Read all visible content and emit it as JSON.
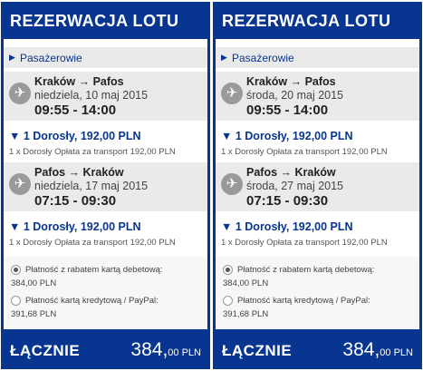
{
  "panels": [
    {
      "header": "REZERWACJA LOTU",
      "passengers_label": "Pasażerowie",
      "flights": [
        {
          "route": "Kraków → Pafos",
          "date": "niedziela, 10 maj 2015",
          "time": "09:55 - 14:00",
          "pax_label": "1 Dorosły, 192,00 PLN",
          "pax_detail": "1 x Dorosły Opłata za transport 192,00 PLN"
        },
        {
          "route": "Pafos → Kraków",
          "date": "niedziela, 17 maj 2015",
          "time": "07:15 - 09:30",
          "pax_label": "1 Dorosły, 192,00 PLN",
          "pax_detail": "1 x Dorosły Opłata za transport 192,00 PLN"
        }
      ],
      "payment": [
        {
          "label": "Płatność z rabatem kartą debetową:",
          "amount": "384,00 PLN",
          "selected": true
        },
        {
          "label": "Płatność kartą kredytową / PayPal:",
          "amount": "391,68 PLN",
          "selected": false
        }
      ],
      "total_label": "ŁĄCZNIE",
      "total_int": "384,",
      "total_dec": "00 PLN"
    },
    {
      "header": "REZERWACJA LOTU",
      "passengers_label": "Pasażerowie",
      "flights": [
        {
          "route": "Kraków → Pafos",
          "date": "środa, 20 maj 2015",
          "time": "09:55 - 14:00",
          "pax_label": "1 Dorosły, 192,00 PLN",
          "pax_detail": "1 x Dorosły Opłata za transport 192,00 PLN"
        },
        {
          "route": "Pafos → Kraków",
          "date": "środa, 27 maj 2015",
          "time": "07:15 - 09:30",
          "pax_label": "1 Dorosły, 192,00 PLN",
          "pax_detail": "1 x Dorosły Opłata za transport 192,00 PLN"
        }
      ],
      "payment": [
        {
          "label": "Płatność z rabatem kartą debetową:",
          "amount": "384,00 PLN",
          "selected": true
        },
        {
          "label": "Płatność kartą kredytową / PayPal:",
          "amount": "391,68 PLN",
          "selected": false
        }
      ],
      "total_label": "ŁĄCZNIE",
      "total_int": "384,",
      "total_dec": "00 PLN"
    }
  ],
  "icons": {
    "expand": "triangle-right-icon",
    "collapse": "triangle-down-icon",
    "plane": "plane-icon"
  },
  "colors": {
    "brand": "#073590",
    "section_bg": "#eaeaea"
  }
}
